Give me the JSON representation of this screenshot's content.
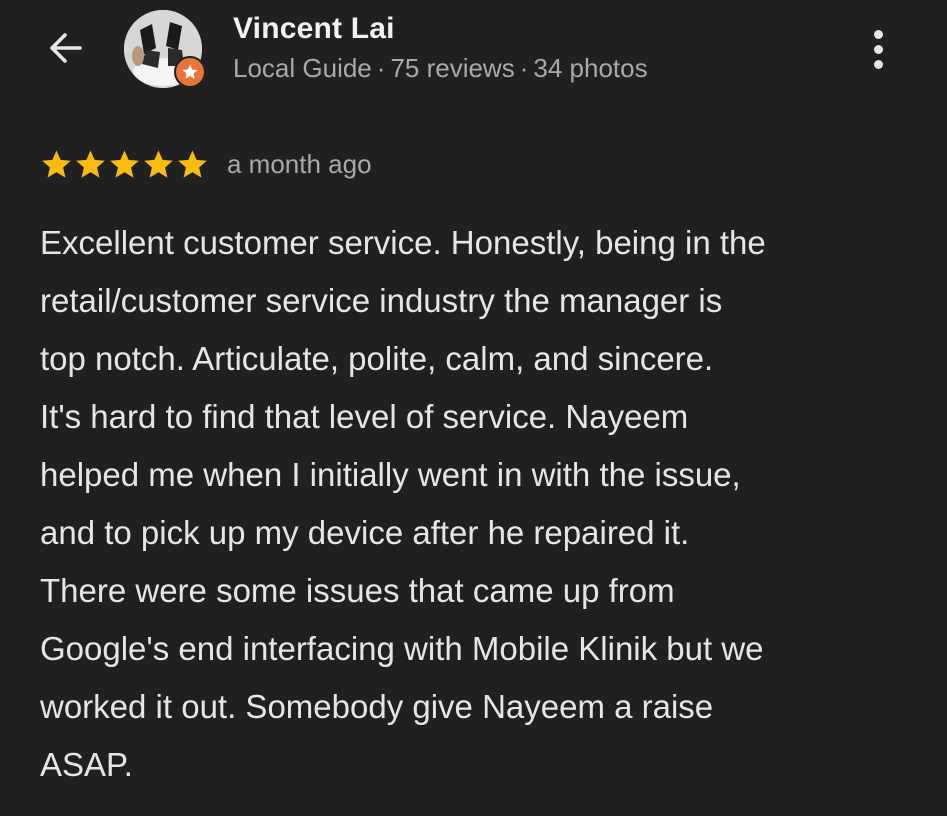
{
  "header": {
    "back_icon": "arrow-left-icon",
    "avatar_icon": "avatar",
    "badge_icon": "local-guide-star-badge",
    "reviewer_name": "Vincent Lai",
    "meta": {
      "level": "Local Guide",
      "separator": "·",
      "reviews": "75 reviews",
      "photos": "34 photos"
    },
    "more_icon": "more-vertical-icon"
  },
  "review": {
    "rating": 5,
    "rating_max": 5,
    "star_color": "#f9bb12",
    "time_ago": "a month ago",
    "lines": [
      "Excellent customer service. Honestly, being in the",
      "retail/customer service industry the manager is",
      "top notch. Articulate, polite, calm, and sincere.",
      "It's hard to find that level of service. Nayeem",
      "helped me when I initially went in with the issue,",
      "and to pick up my device after he repaired it.",
      "There were some issues that came up from",
      "Google's end interfacing with Mobile Klinik but we",
      "worked it out. Somebody give Nayeem a raise",
      "ASAP."
    ]
  },
  "colors": {
    "background": "#202020",
    "text_primary": "#e6e6e6",
    "text_secondary": "#a9a9a9",
    "badge": "#e8743b"
  }
}
